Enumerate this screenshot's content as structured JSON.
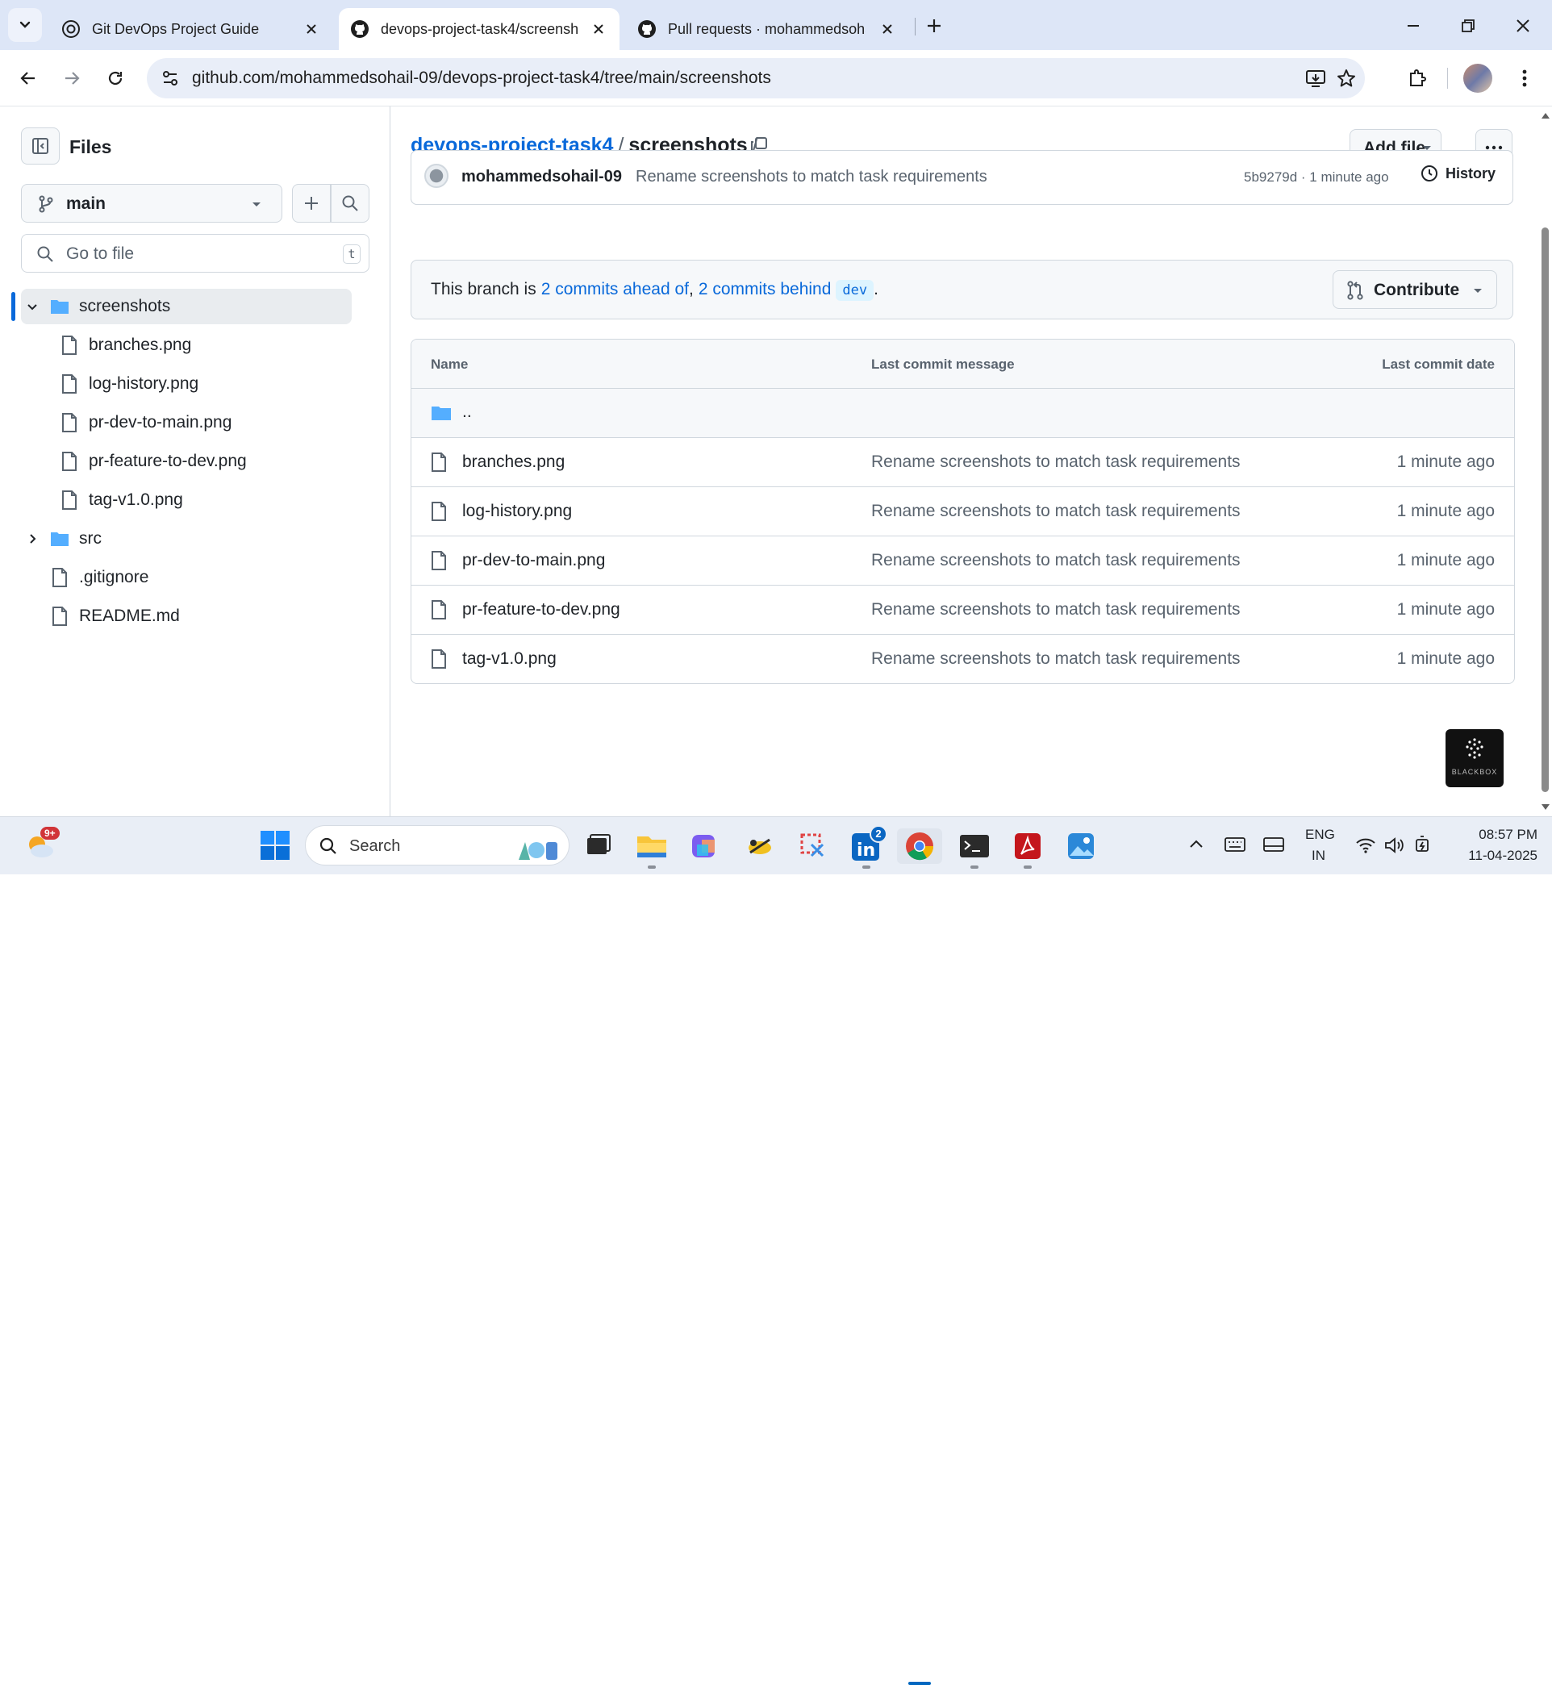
{
  "browser": {
    "tabs": [
      {
        "title": "Git DevOps Project Guide",
        "icon": "openai-icon",
        "active": false
      },
      {
        "title": "devops-project-task4/screenshots",
        "icon": "github-icon",
        "active": true
      },
      {
        "title": "Pull requests · mohammedsohail-09",
        "icon": "github-icon",
        "active": false
      }
    ],
    "url": "github.com/mohammedsohail-09/devops-project-task4/tree/main/screenshots"
  },
  "sidebar": {
    "title": "Files",
    "branch": "main",
    "go_to_file_placeholder": "Go to file",
    "go_to_file_shortcut": "t",
    "tree": [
      {
        "label": "screenshots",
        "type": "folder",
        "expanded": true,
        "selected": true
      },
      {
        "label": "branches.png",
        "type": "file",
        "child": true
      },
      {
        "label": "log-history.png",
        "type": "file",
        "child": true
      },
      {
        "label": "pr-dev-to-main.png",
        "type": "file",
        "child": true
      },
      {
        "label": "pr-feature-to-dev.png",
        "type": "file",
        "child": true
      },
      {
        "label": "tag-v1.0.png",
        "type": "file",
        "child": true
      },
      {
        "label": "src",
        "type": "folder",
        "expanded": false
      },
      {
        "label": ".gitignore",
        "type": "file"
      },
      {
        "label": "README.md",
        "type": "file"
      }
    ]
  },
  "main": {
    "breadcrumb": {
      "repo": "devops-project-task4",
      "sep1": "/",
      "folder": "screenshots",
      "sep2": "/"
    },
    "add_file_label": "Add file",
    "commit": {
      "author": "mohammedsohail-09",
      "message": "Rename screenshots to match task requirements",
      "meta": "5b9279d · 1 minute ago",
      "history_label": "History"
    },
    "branch_status": {
      "prefix": "This branch is",
      "ahead": "2 commits ahead of",
      "comma": ",",
      "behind": "2 commits behind",
      "base": "dev",
      "suffix": ".",
      "contribute_label": "Contribute"
    },
    "table": {
      "headers": {
        "name": "Name",
        "message": "Last commit message",
        "date": "Last commit date"
      },
      "parent_dir": "..",
      "rows": [
        {
          "name": "branches.png",
          "message": "Rename screenshots to match task requirements",
          "date": "1 minute ago"
        },
        {
          "name": "log-history.png",
          "message": "Rename screenshots to match task requirements",
          "date": "1 minute ago"
        },
        {
          "name": "pr-dev-to-main.png",
          "message": "Rename screenshots to match task requirements",
          "date": "1 minute ago"
        },
        {
          "name": "pr-feature-to-dev.png",
          "message": "Rename screenshots to match task requirements",
          "date": "1 minute ago"
        },
        {
          "name": "tag-v1.0.png",
          "message": "Rename screenshots to match task requirements",
          "date": "1 minute ago"
        }
      ]
    },
    "blackbox_label": "BLACKBOX"
  },
  "taskbar": {
    "weather_badge": "9+",
    "search_placeholder": "Search",
    "linkedin_badge": "2",
    "language": "ENG",
    "region": "IN",
    "time": "08:57 PM",
    "date": "11-04-2025"
  },
  "colors": {
    "link": "#0969da",
    "folder": "#54aeff",
    "accent_blue": "#0969da"
  }
}
